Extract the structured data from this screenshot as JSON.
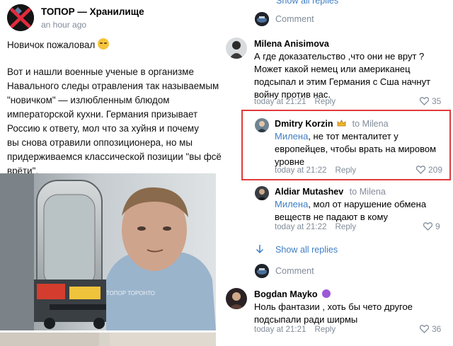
{
  "post": {
    "group_name": "ТОПОР — Хранилище",
    "time": "an hour ago",
    "text_line1": "Новичок пожаловал",
    "text_body": [
      "Вот и нашли военные ученые в организме",
      "Навального следы отравления так называемым",
      "\"новичком\" — излюбленным блюдом",
      "императорской кухни. Германия призывает",
      "Россию к ответу, мол что за хуйня и почему",
      "вы снова отравили оппозиционера, но мы",
      "придерживаемся классической позиции \"вы фсё",
      "врёти\"."
    ]
  },
  "thread1": {
    "show_all_top": "Show all replies",
    "comment_label": "Comment"
  },
  "comments": [
    {
      "author": "Milena Anisimova",
      "to": "",
      "mention": "",
      "text": [
        "А где доказательство ,что они не врут ?",
        "Может какой немец или американец",
        "подсыпал  и этим  Германия с Сша начнут",
        "войну против нас."
      ],
      "time": "today at 21:21",
      "reply": "Reply",
      "likes": "35"
    },
    {
      "author": "Dmitry Korzin",
      "to": "to Milena",
      "mention": "Милена",
      "text": [
        ", не тот менталитет у",
        "европейцев, чтобы врать на мировом",
        "уровне"
      ],
      "time": "today at 21:22",
      "reply": "Reply",
      "likes": "209"
    },
    {
      "author": "Aldiar Mutashev",
      "to": "to Milena",
      "mention": "Милена",
      "text": [
        ", мол от нарушение обмена",
        "веществ не падают в кому"
      ],
      "time": "today at 21:22",
      "reply": "Reply",
      "likes": "9"
    },
    {
      "author": "Bogdan Mayko",
      "to": "",
      "mention": "",
      "text": [
        "Ноль фантазии , хоть бы чето другое",
        "подсыпали ради ширмы"
      ],
      "time": "today at 21:21",
      "reply": "Reply",
      "likes": "36"
    }
  ],
  "thread2": {
    "show_all": "Show all replies",
    "comment_label": "Comment"
  },
  "photo": {
    "watermark": "ТОПОР ТОРОНТО"
  },
  "colors": {
    "link": "#3f7ec4",
    "muted": "#818c99",
    "highlight": "#e23a3a"
  }
}
